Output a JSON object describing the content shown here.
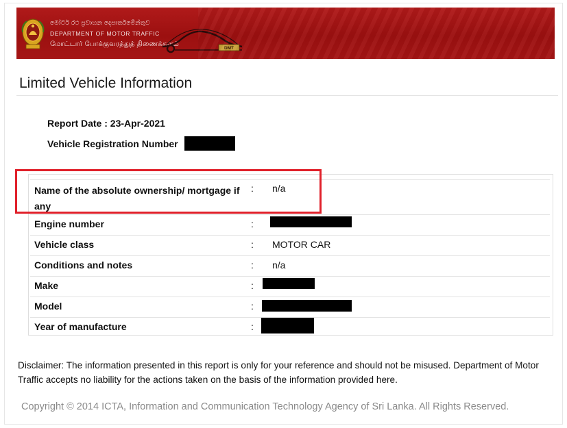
{
  "header": {
    "sinhala_line": "මෝටර් රථ ප්‍රවාහන දෙපාර්තමේන්තුව",
    "english_line": "DEPARTMENT OF MOTOR TRAFFIC",
    "tamil_line": "மோட்டார் போக்குவரத்துத் திணைக்களம்",
    "logo_text": "DMT"
  },
  "page_title": "Limited Vehicle Information",
  "report": {
    "date_line": "Report Date : 23-Apr-2021",
    "reg_label": "Vehicle Registration Number"
  },
  "rows": [
    {
      "label": "Name of the absolute ownership/ mortgage if any",
      "colon": ":",
      "value": "n/a"
    },
    {
      "label": "Engine number",
      "colon": ":",
      "value": ""
    },
    {
      "label": "Vehicle class",
      "colon": ":",
      "value": "MOTOR CAR"
    },
    {
      "label": "Conditions and notes",
      "colon": ":",
      "value": "n/a"
    },
    {
      "label": "Make",
      "colon": ":",
      "value": ""
    },
    {
      "label": "Model",
      "colon": ":",
      "value": ""
    },
    {
      "label": "Year of manufacture",
      "colon": ":",
      "value": ""
    }
  ],
  "disclaimer": "Disclaimer: The information presented in this report is only for your reference and should not be misused. Department of Motor Traffic accepts no liability for the actions taken on the basis of the information provided here.",
  "copyright": "Copyright  ©  2014 ICTA, Information and Communication Technology Agency of Sri Lanka. All Rights Reserved.",
  "colors": {
    "banner_red": "#a51515",
    "highlight_red": "#e0202a",
    "copyright_gray": "#8a8a8a"
  }
}
